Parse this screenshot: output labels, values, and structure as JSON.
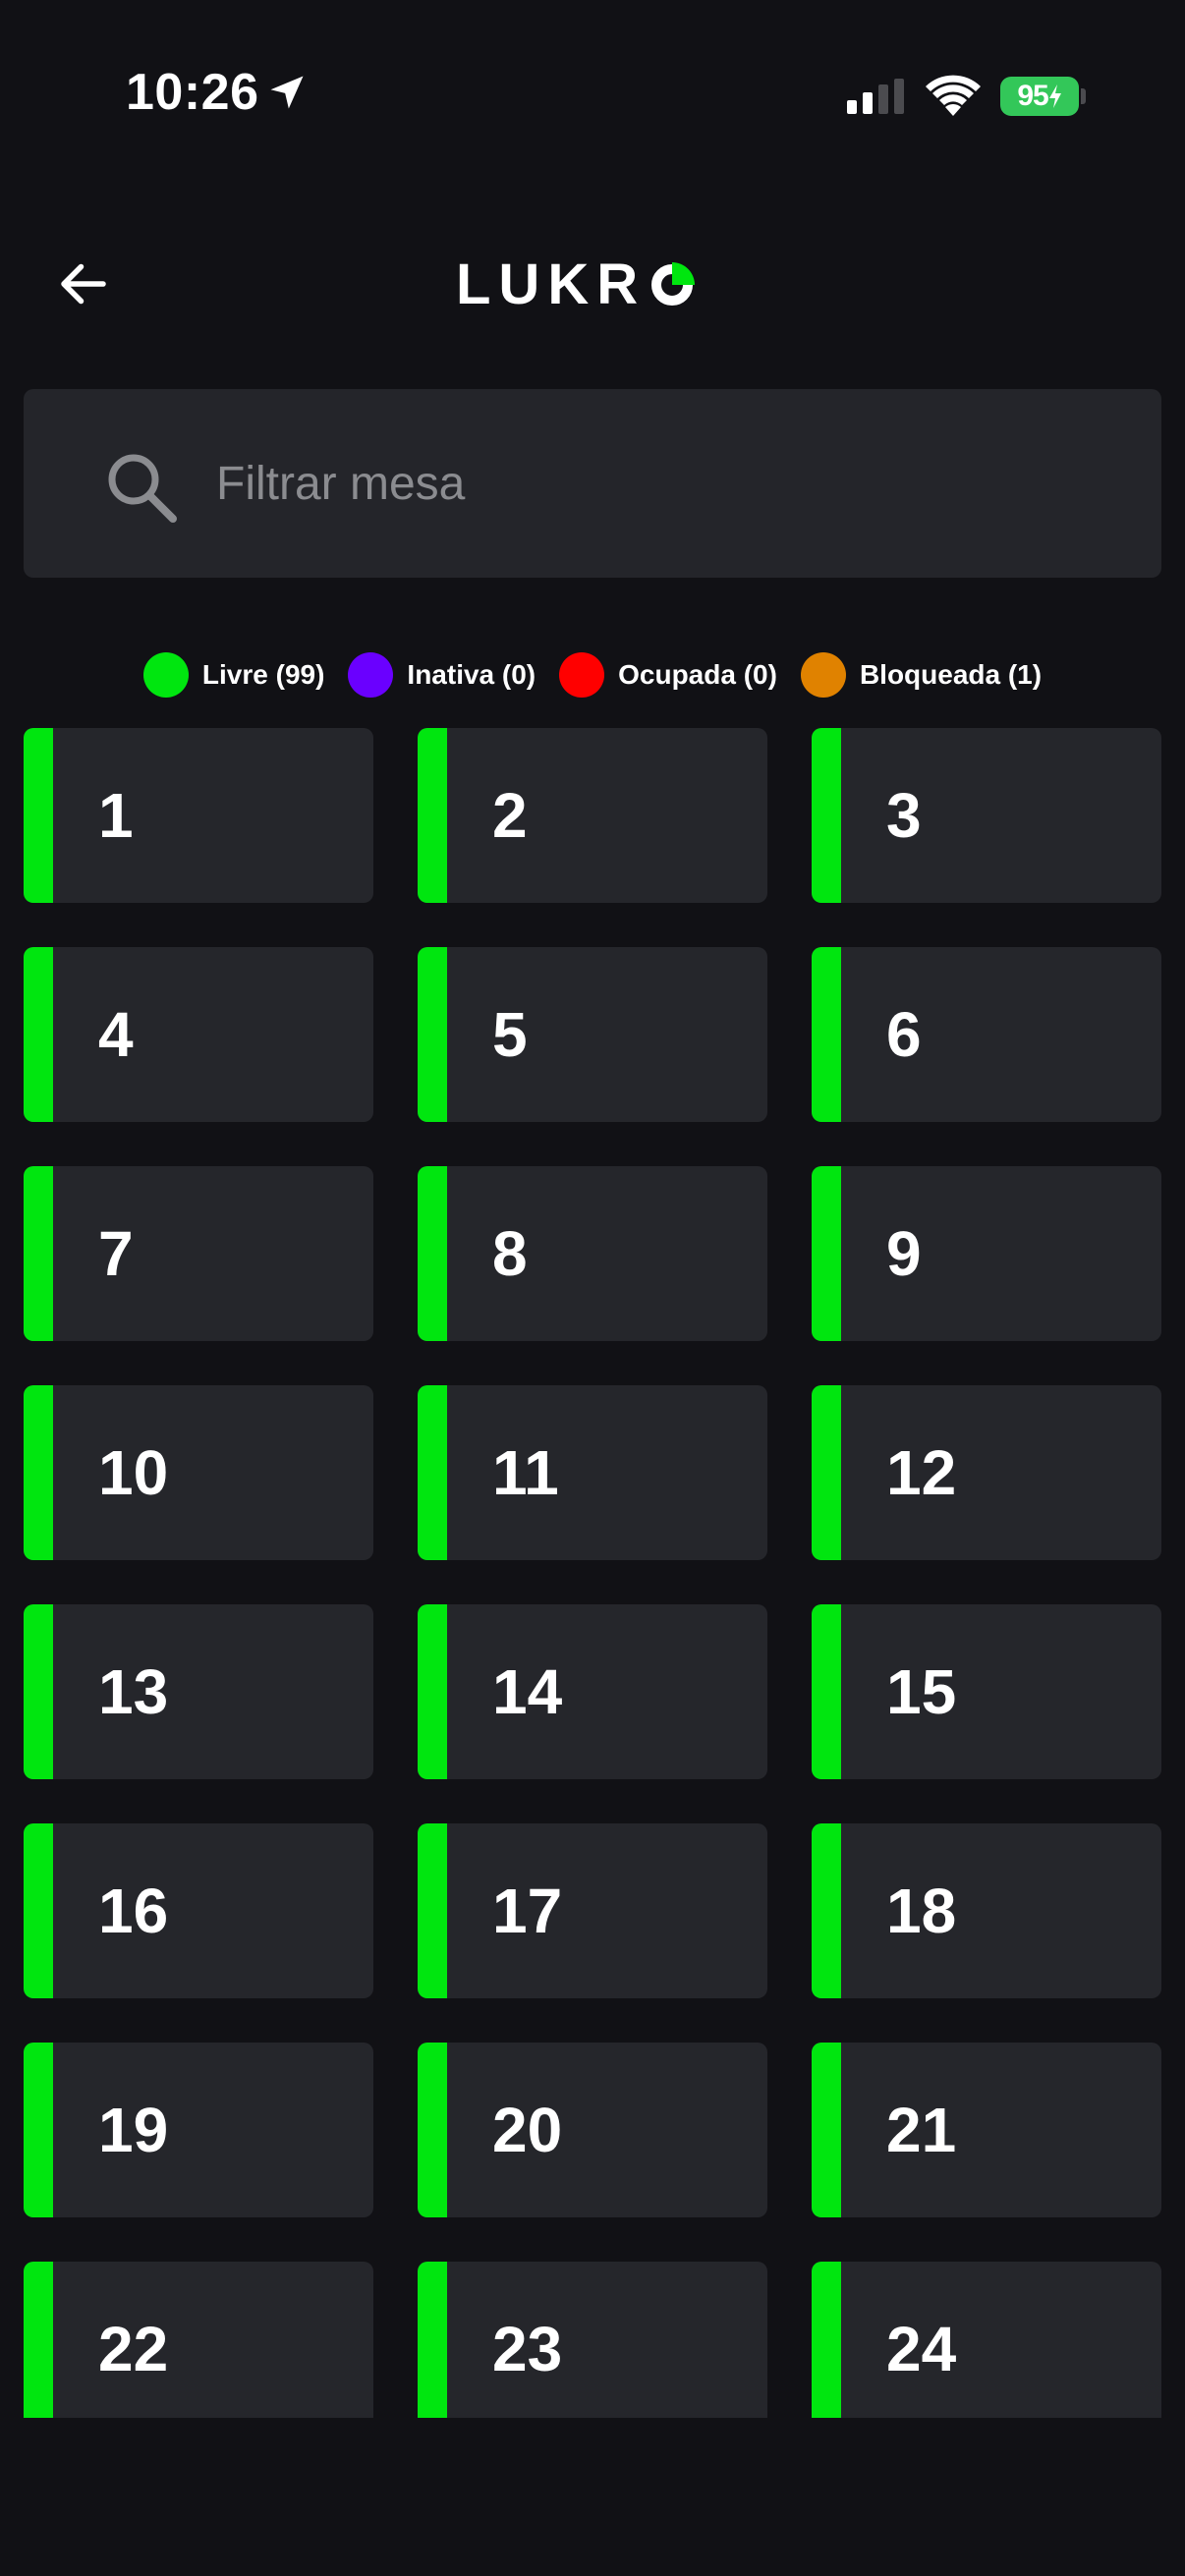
{
  "status_bar": {
    "time": "10:26",
    "battery": "95",
    "battery_color": "#33c759"
  },
  "header": {
    "logo_text": "LUKR",
    "logo_mark_colors": [
      "#ffffff",
      "#00e60f"
    ]
  },
  "search": {
    "placeholder": "Filtrar mesa",
    "value": ""
  },
  "legend": [
    {
      "label": "Livre (99)",
      "color": "#00e60f"
    },
    {
      "label": "Inativa (0)",
      "color": "#6a00ff"
    },
    {
      "label": "Ocupada (0)",
      "color": "#ff0000"
    },
    {
      "label": "Bloqueada (1)",
      "color": "#e08200"
    }
  ],
  "tables": [
    {
      "number": "1",
      "status": "livre"
    },
    {
      "number": "2",
      "status": "livre"
    },
    {
      "number": "3",
      "status": "livre"
    },
    {
      "number": "4",
      "status": "livre"
    },
    {
      "number": "5",
      "status": "livre"
    },
    {
      "number": "6",
      "status": "livre"
    },
    {
      "number": "7",
      "status": "livre"
    },
    {
      "number": "8",
      "status": "livre"
    },
    {
      "number": "9",
      "status": "livre"
    },
    {
      "number": "10",
      "status": "livre"
    },
    {
      "number": "11",
      "status": "livre"
    },
    {
      "number": "12",
      "status": "livre"
    },
    {
      "number": "13",
      "status": "livre"
    },
    {
      "number": "14",
      "status": "livre"
    },
    {
      "number": "15",
      "status": "livre"
    },
    {
      "number": "16",
      "status": "livre"
    },
    {
      "number": "17",
      "status": "livre"
    },
    {
      "number": "18",
      "status": "livre"
    },
    {
      "number": "19",
      "status": "livre"
    },
    {
      "number": "20",
      "status": "livre"
    },
    {
      "number": "21",
      "status": "livre"
    },
    {
      "number": "22",
      "status": "livre"
    },
    {
      "number": "23",
      "status": "livre"
    },
    {
      "number": "24",
      "status": "livre"
    }
  ],
  "status_colors": {
    "livre": "#00e60f"
  }
}
